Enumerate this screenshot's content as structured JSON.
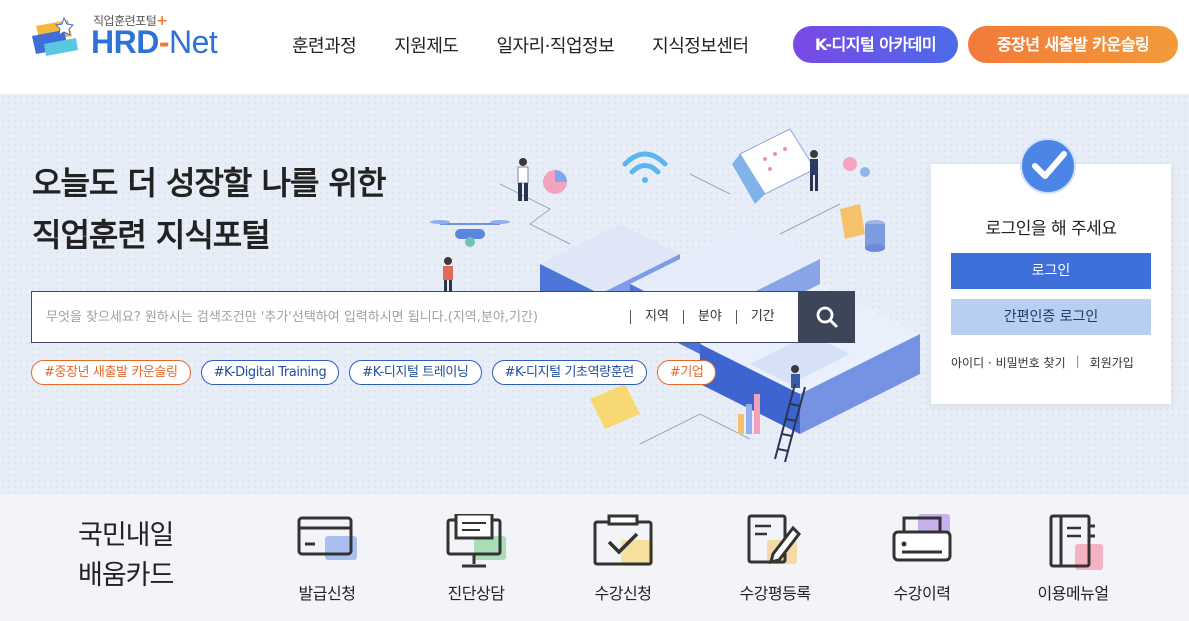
{
  "header": {
    "logo_sub": "직업훈련포털",
    "logo_plus": "+",
    "logo_hrd": "HRD",
    "logo_dash": "-",
    "logo_net": "Net",
    "nav": [
      "훈련과정",
      "지원제도",
      "일자리·직업정보",
      "지식정보센터"
    ],
    "kdt_button": "K-디지털 아카데미",
    "midlife_button": "중장년 새출발 카운슬링"
  },
  "hero": {
    "title_line1": "오늘도 더 성장할 나를 위한",
    "title_line2": "직업훈련 지식포털",
    "search": {
      "placeholder": "무엇을 찾으세요? 원하시는 검색조건만 '추가'선택하여 입력하시면 됩니다.(지역,분야,기간)",
      "filters": [
        "지역",
        "분야",
        "기간"
      ]
    },
    "tags": [
      {
        "label": "#중장년 새출발 카운슬링",
        "color": "orange"
      },
      {
        "label": "#K-Digital Training",
        "color": "blue"
      },
      {
        "label": "#K-디지털 트레이닝",
        "color": "blue"
      },
      {
        "label": "#K-디지털 기초역량훈련",
        "color": "blue"
      },
      {
        "label": "#기업",
        "color": "orange"
      }
    ]
  },
  "login": {
    "title": "로그인을 해 주세요",
    "login_button": "로그인",
    "simple_login_button": "간편인증 로그인",
    "find_link": "아이디 · 비밀번호 찾기",
    "separator": "|",
    "signup_link": "회원가입"
  },
  "quick": {
    "card_title_line1": "국민내일",
    "card_title_line2": "배움카드",
    "items": [
      {
        "label": "발급신청",
        "icon": "card-icon"
      },
      {
        "label": "진단상담",
        "icon": "monitor-icon"
      },
      {
        "label": "수강신청",
        "icon": "check-folder-icon"
      },
      {
        "label": "수강평등록",
        "icon": "pen-doc-icon"
      },
      {
        "label": "수강이력",
        "icon": "printer-icon"
      },
      {
        "label": "이용메뉴얼",
        "icon": "manual-icon"
      }
    ]
  },
  "colors": {
    "brand_blue": "#2e72d8",
    "brand_orange": "#f47a2a",
    "login_blue": "#3f6fd8",
    "search_btn": "#3c4658"
  }
}
